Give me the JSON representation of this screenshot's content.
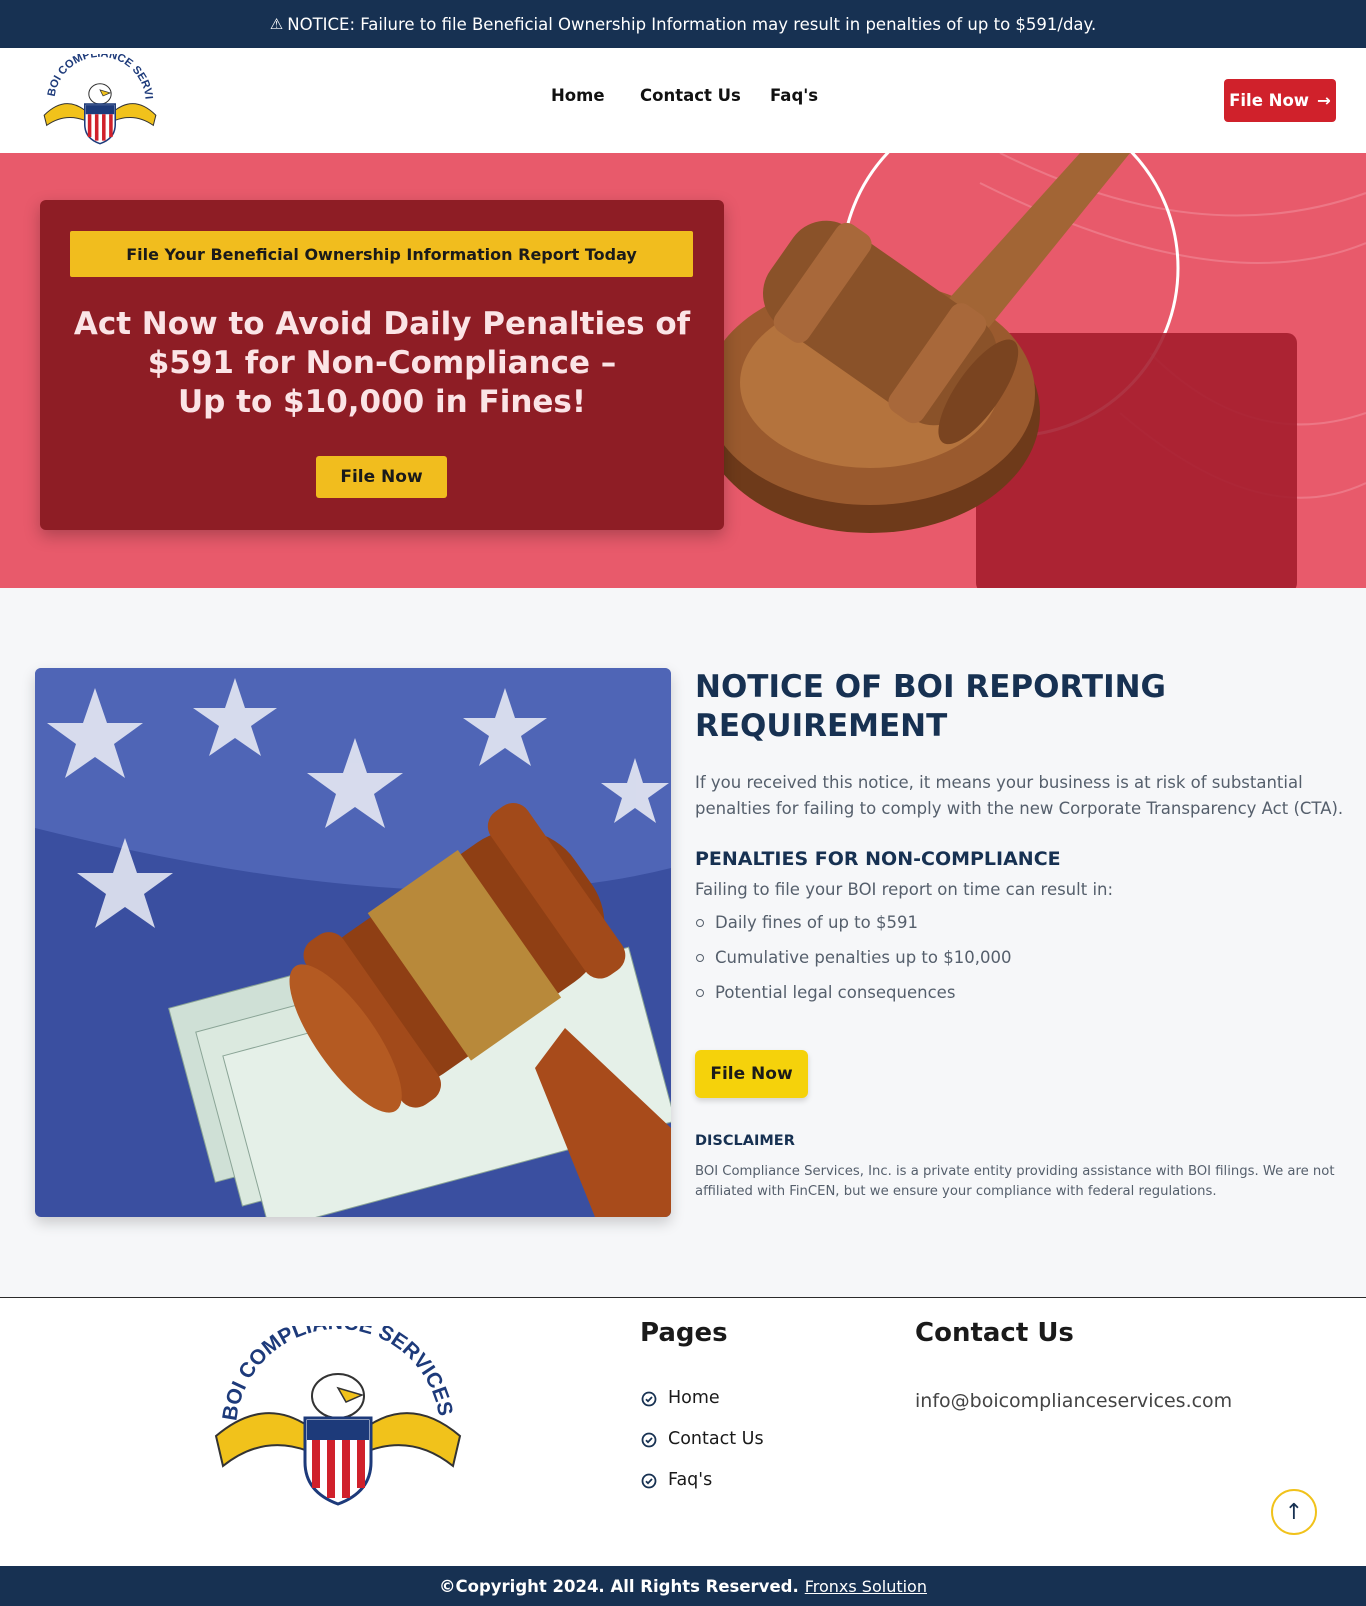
{
  "notice_bar": {
    "icon": "warning-icon",
    "text": "NOTICE: Failure to file Beneficial Ownership Information may result in penalties of up to $591/day."
  },
  "brand": {
    "logo_text": "BOI COMPLIANCE SERVICES",
    "colors": {
      "navy": "#173152",
      "red": "#d0212b",
      "yellow": "#f1bd1e",
      "maroon": "#8e1d25"
    }
  },
  "nav": {
    "items": [
      {
        "label": "Home"
      },
      {
        "label": "Contact Us"
      },
      {
        "label": "Faq's"
      }
    ],
    "cta_label": "File Now"
  },
  "hero": {
    "tag": "File Your Beneficial Ownership Information Report Today",
    "title_line1": "Act Now to Avoid Daily Penalties of",
    "title_line2": "$591 for Non-Compliance –",
    "title_line3": "Up to $10,000 in Fines!",
    "button": "File Now"
  },
  "notice": {
    "title_line1": "NOTICE OF BOI REPORTING",
    "title_line2": "REQUIREMENT",
    "intro": "If you received this notice, it means your business is at risk of substantial penalties for failing to comply with the new Corporate Transparency Act (CTA).",
    "penalties_title": "PENALTIES FOR NON-COMPLIANCE",
    "penalties_intro": "Failing to file your BOI report on time can result in:",
    "penalties": [
      "Daily fines of up to $591",
      "Cumulative penalties up to $10,000",
      "Potential legal consequences"
    ],
    "button": "File Now",
    "disclaimer_title": "DISCLAIMER",
    "disclaimer_text": "BOI Compliance Services, Inc. is a private entity providing assistance with BOI filings. We are not affiliated with FinCEN, but we ensure your compliance with federal regulations."
  },
  "footer": {
    "pages_title": "Pages",
    "pages": [
      "Home",
      "Contact Us",
      "Faq's"
    ],
    "contact_title": "Contact Us",
    "email": "info@boicomplianceservices.com",
    "copyright": "©Copyright 2024. All Rights Reserved.",
    "credit": "Fronxs Solution"
  }
}
